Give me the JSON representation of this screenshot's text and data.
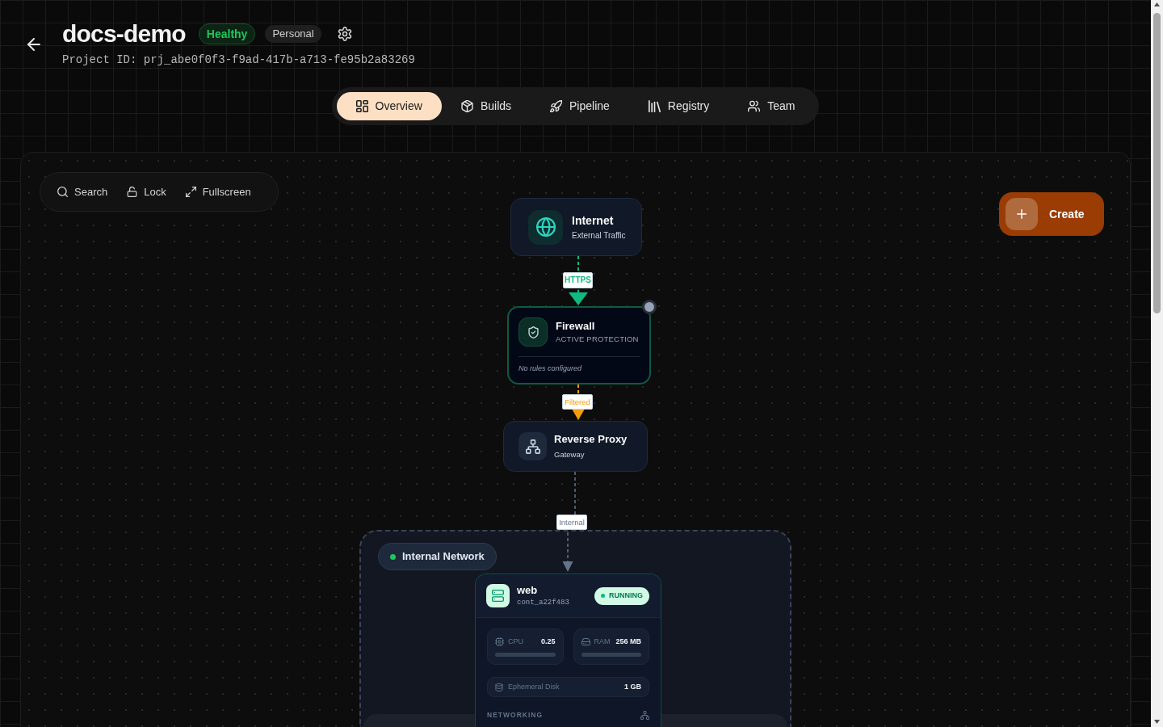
{
  "header": {
    "title": "docs-demo",
    "badges": [
      {
        "label": "Healthy",
        "kind": "health"
      },
      {
        "label": "Personal",
        "kind": "plan"
      }
    ],
    "project_id": "Project ID: prj_abe0f0f3-f9ad-417b-a713-fe95b2a83269"
  },
  "tabs": [
    {
      "label": "Overview",
      "selected": true
    },
    {
      "label": "Builds",
      "selected": false
    },
    {
      "label": "Pipeline",
      "selected": false
    },
    {
      "label": "Registry",
      "selected": false
    },
    {
      "label": "Team",
      "selected": false
    }
  ],
  "canvas": {
    "toolbar": [
      {
        "label": "Search"
      },
      {
        "label": "Lock"
      },
      {
        "label": "Fullscreen"
      }
    ],
    "create_button": {
      "label": "Create"
    },
    "nodes": [
      {
        "kind": "internet",
        "title": "Internet",
        "subtitle": "External Traffic"
      },
      {
        "kind": "firewall",
        "title": "Firewall",
        "subtitle": "ACTIVE PROTECTION",
        "note": "No rules configured"
      },
      {
        "kind": "proxy",
        "title": "Reverse Proxy",
        "subtitle": "Gateway"
      }
    ],
    "edges": [
      {
        "label": "HTTPS",
        "color": "#10b981"
      },
      {
        "label": "Filtered",
        "color": "#f59e0b"
      },
      {
        "label": "Internal",
        "color": "#64748b"
      }
    ],
    "network": {
      "label": "Internal Network",
      "services": [
        {
          "name": "web",
          "container_id": "cont_a22f483",
          "status": "RUNNING",
          "metrics": [
            {
              "label": "CPU",
              "value": "0.25"
            },
            {
              "label": "RAM",
              "value": "256 MB"
            }
          ],
          "disk": {
            "label": "Ephemeral Disk",
            "value": "1 GB"
          },
          "section": "NETWORKING"
        }
      ]
    }
  }
}
